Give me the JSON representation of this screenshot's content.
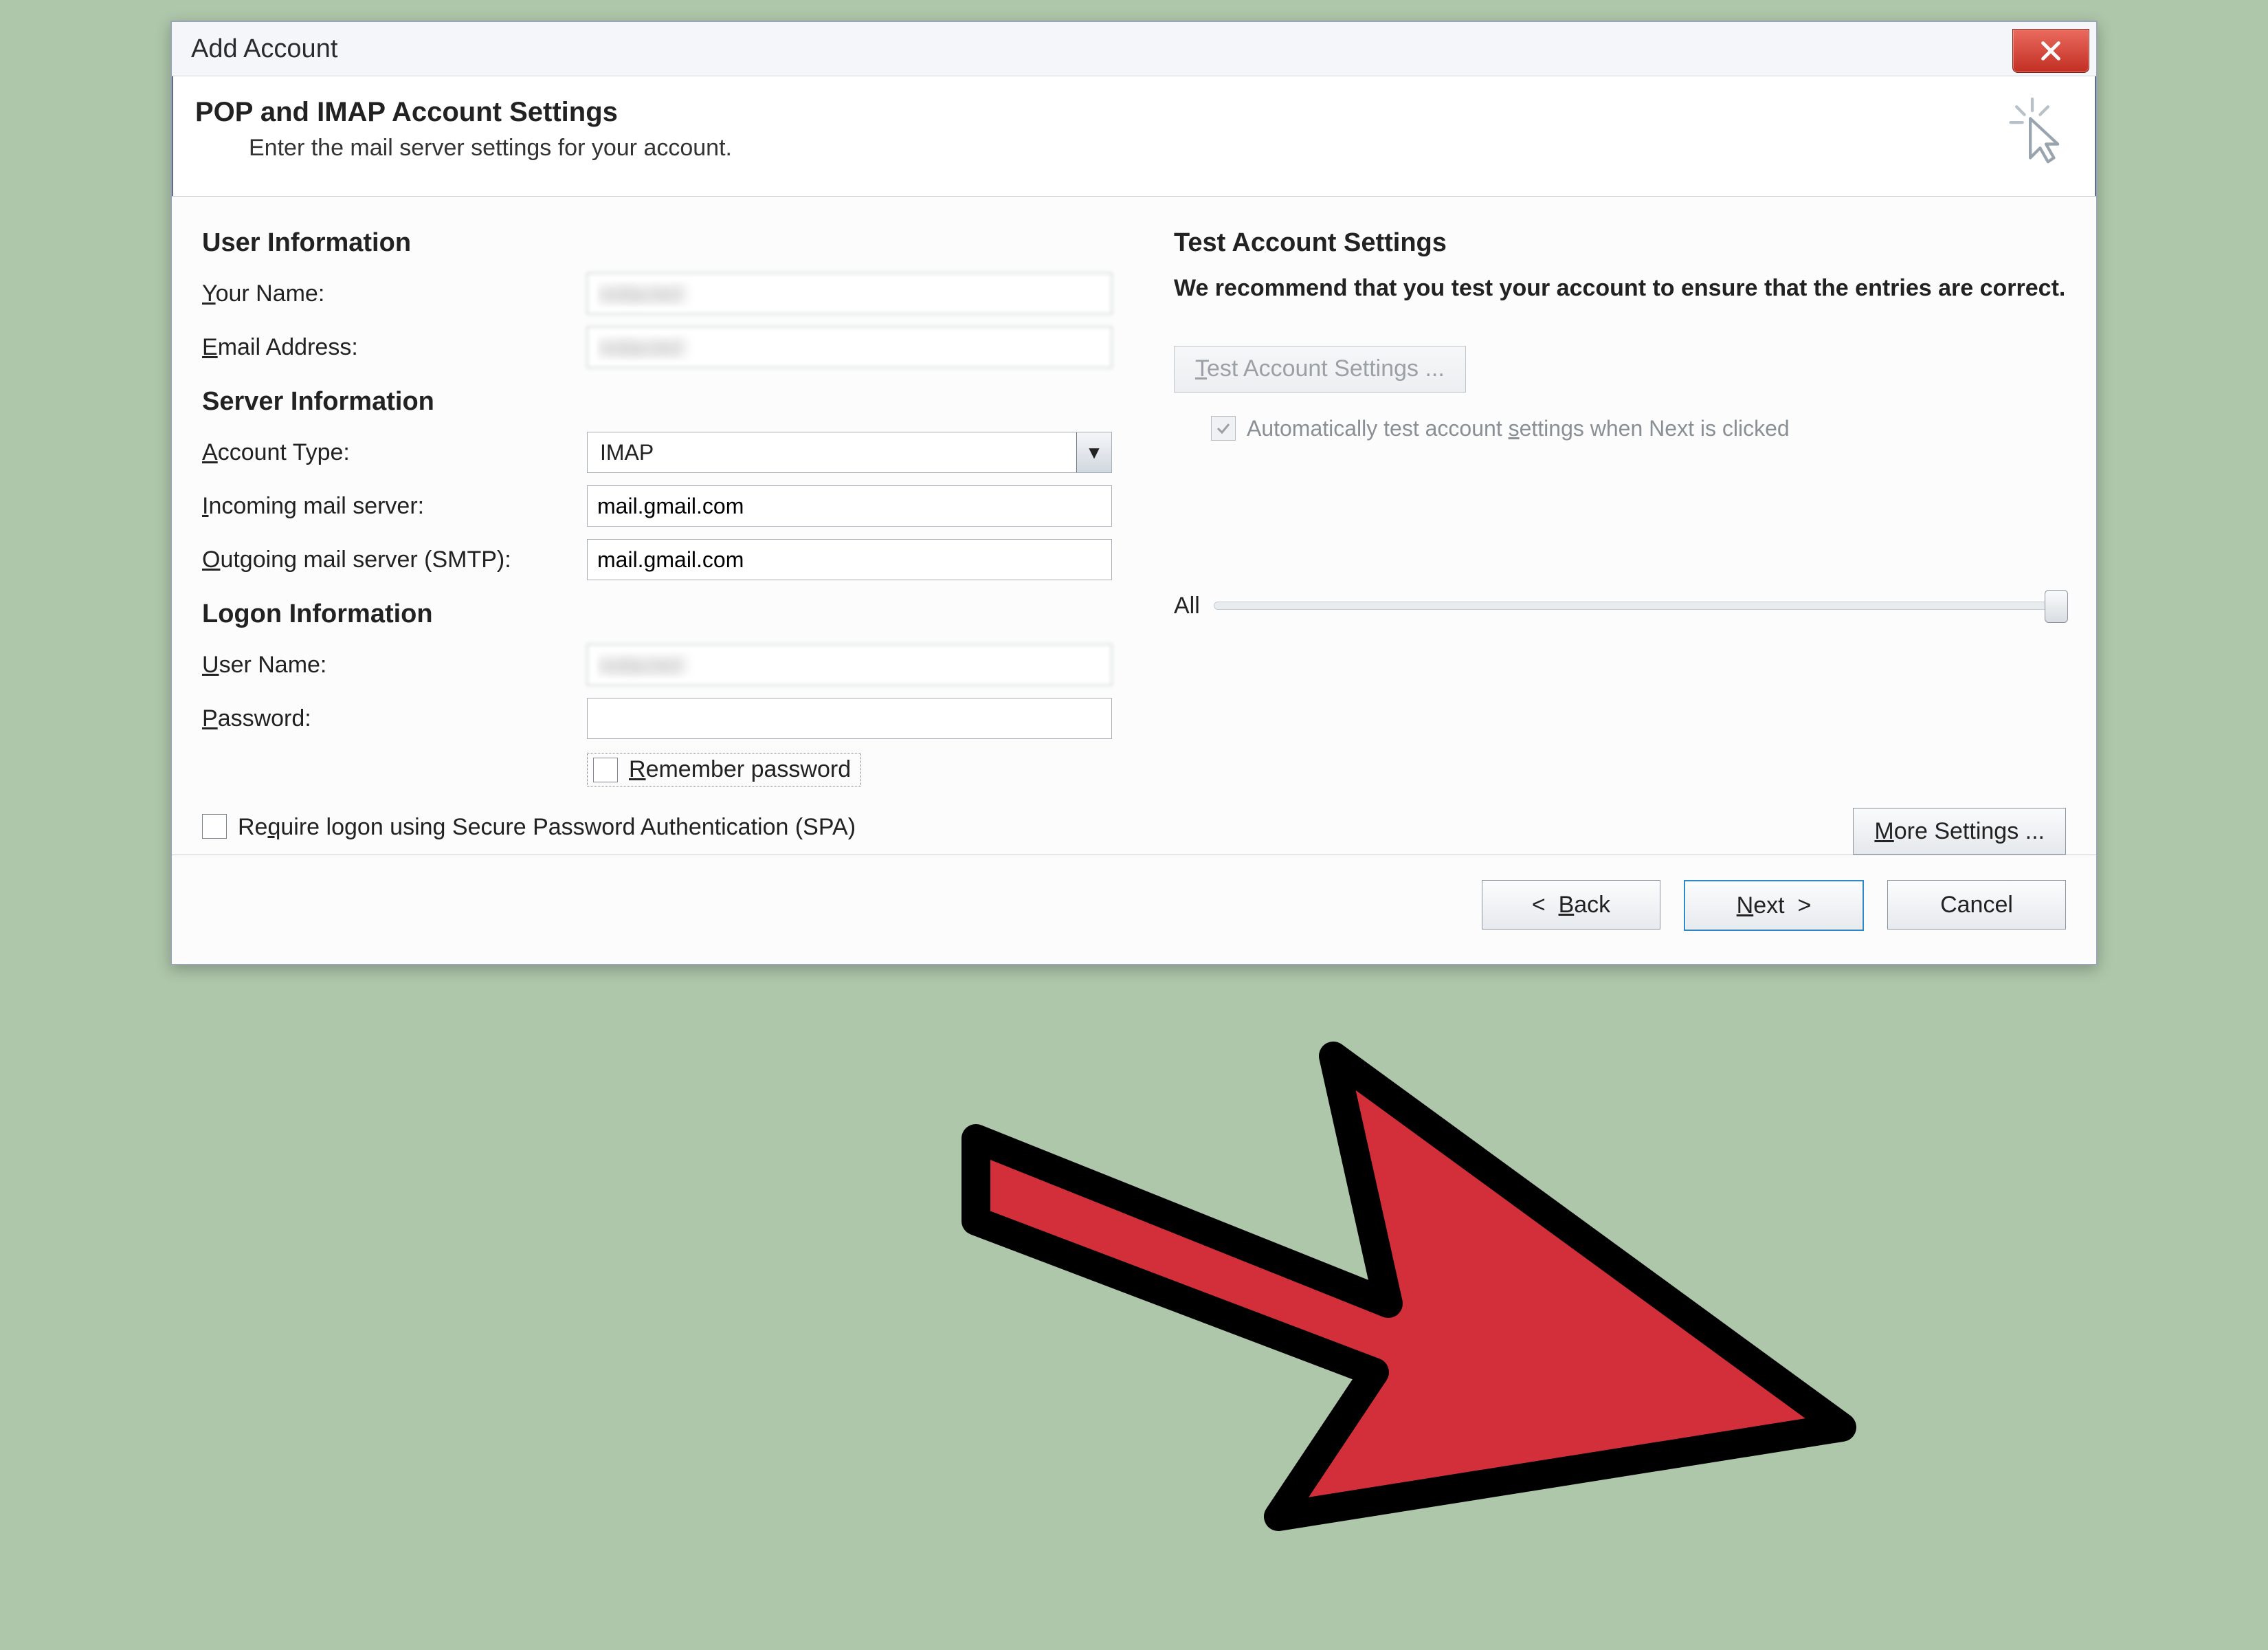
{
  "window": {
    "title": "Add Account"
  },
  "banner": {
    "heading": "POP and IMAP Account Settings",
    "sub": "Enter the mail server settings for your account."
  },
  "left": {
    "user_info_title": "User Information",
    "your_name_label": "Your Name:",
    "your_name_value": "redacted",
    "email_label": "Email Address:",
    "email_value": "redacted",
    "server_info_title": "Server Information",
    "account_type_label": "Account Type:",
    "account_type_value": "IMAP",
    "incoming_label": "Incoming mail server:",
    "incoming_value": "mail.gmail.com",
    "outgoing_label": "Outgoing mail server (SMTP):",
    "outgoing_value": "mail.gmail.com",
    "logon_info_title": "Logon Information",
    "username_label": "User Name:",
    "username_value": "redacted",
    "password_label": "Password:",
    "password_value": "",
    "remember_password_label": "Remember password",
    "spa_label": "Require logon using Secure Password Authentication (SPA)"
  },
  "right": {
    "title": "Test Account Settings",
    "blurb": "We recommend that you test your account to ensure that the entries are correct.",
    "test_btn": "Test Account Settings ...",
    "auto_test_label": "Automatically test account settings when Next is clicked",
    "slider_end_label": "All",
    "more_settings_btn": "More Settings ..."
  },
  "footer": {
    "back": "<  Back",
    "next": "Next  >",
    "cancel": "Cancel"
  }
}
